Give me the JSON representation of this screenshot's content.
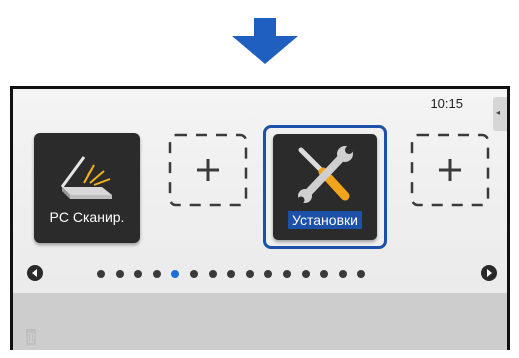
{
  "header": {
    "time": "10:15"
  },
  "tiles": {
    "scanner": {
      "label": "PC Сканир.",
      "icon": "scanner-icon"
    },
    "add_slot_1": {
      "icon": "plus-icon"
    },
    "settings": {
      "label": "Установки",
      "icon": "wrench-screwdriver-icon",
      "selected": true
    },
    "add_slot_2": {
      "icon": "plus-icon"
    }
  },
  "pager": {
    "page_count": 15,
    "active_page": 5
  },
  "tray": {
    "icon": "trash-icon"
  },
  "colors": {
    "accent": "#1d50a8",
    "active_dot": "#1e6ed8",
    "tile": "#2b2b2b",
    "arrow": "#1f5fbf"
  }
}
